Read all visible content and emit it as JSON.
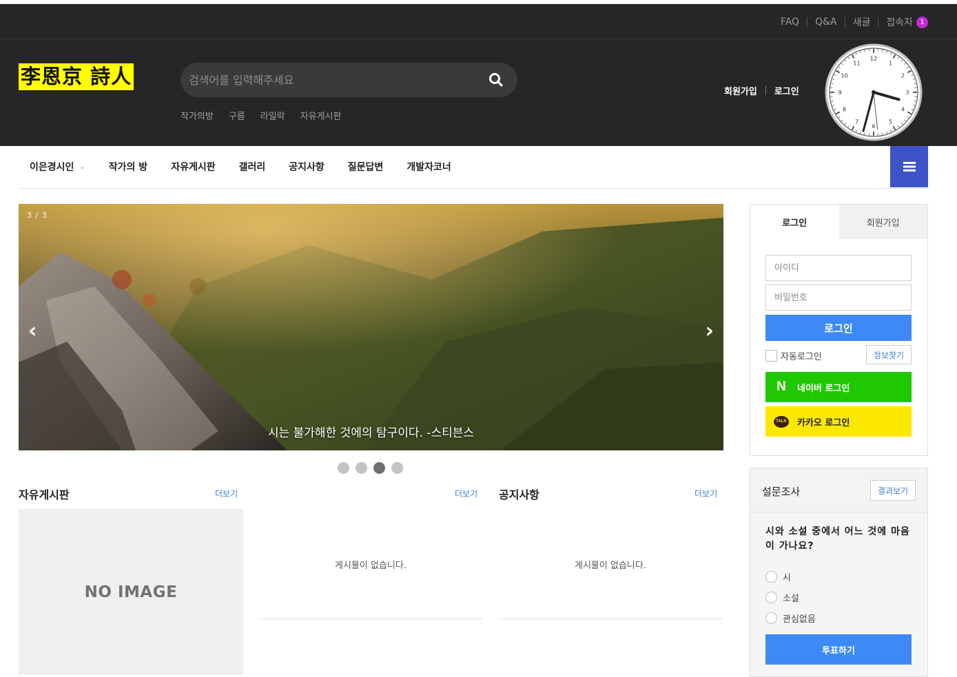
{
  "util": {
    "links": [
      "FAQ",
      "Q&A",
      "새글",
      "접속자"
    ],
    "visitor_count": "1"
  },
  "logo": {
    "text": "李恩京 詩人",
    "bg_color": "#ffff00"
  },
  "search": {
    "placeholder": "검색어를 입력해주세요"
  },
  "quick_links": [
    "작가의방",
    "구름",
    "라일락",
    "자유게시판"
  ],
  "member": {
    "join": "회원가입",
    "login": "로그인"
  },
  "clock": {
    "numbers": [
      "12",
      "1",
      "2",
      "3",
      "4",
      "5",
      "6",
      "7",
      "8",
      "9",
      "10",
      "11"
    ],
    "hour": 3,
    "minute": 32,
    "second": 29
  },
  "nav": {
    "items": [
      "이은경시인",
      "작가의 방",
      "자유게시판",
      "갤러리",
      "공지사항",
      "질문답변",
      "개발자코너"
    ],
    "accent_color": "#3d54c8"
  },
  "slider": {
    "counter": "3 / 3",
    "prev": "‹",
    "next": "›",
    "caption": "시는 불가해한 것에의 탐구이다. -스티븐스",
    "dot_count": 4,
    "active_dot": 3
  },
  "boards": [
    {
      "title": "자유게시판",
      "more": "더보기",
      "thumbnail": "NO IMAGE"
    },
    {
      "title": "",
      "more": "더보기",
      "empty": "게시물이 없습니다."
    },
    {
      "title": "공지사항",
      "more": "더보기",
      "empty": "게시물이 없습니다."
    }
  ],
  "login_box": {
    "tab_login": "로그인",
    "tab_join": "회원가입",
    "id_placeholder": "아이디",
    "pw_placeholder": "비밀번호",
    "login_button": "로그인",
    "auto_login": "자동로그인",
    "find_info": "정보찾기",
    "naver": "네이버 로그인",
    "kakao": "카카오 로그인",
    "naver_icon_text": "N",
    "kakao_icon_text": "TALK",
    "login_color": "#3d8af7",
    "naver_color": "#1fc800",
    "kakao_color": "#fde800"
  },
  "poll": {
    "title": "설문조사",
    "result_button": "결과보기",
    "question": "시와 소설 중에서 어느 것에 마음이 가나요?",
    "options": [
      "시",
      "소설",
      "관심없음"
    ],
    "vote_button": "투표하기"
  }
}
